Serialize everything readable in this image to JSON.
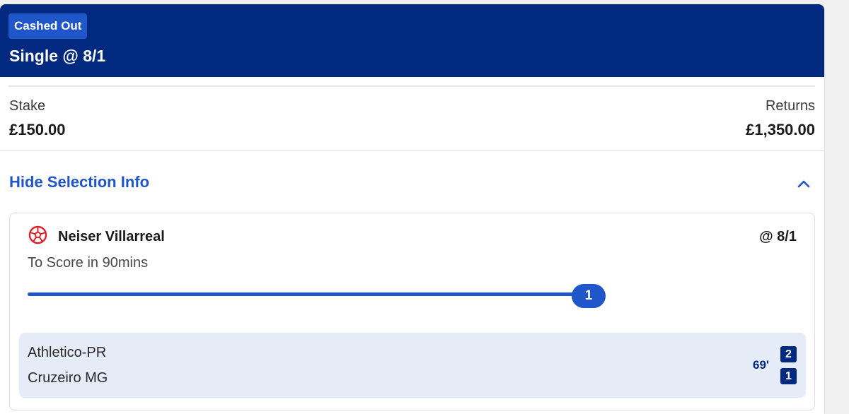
{
  "header": {
    "status_badge": "Cashed Out",
    "bet_title": "Single @ 8/1",
    "background_color": "#00297f",
    "badge_color": "#1f56c9"
  },
  "summary": {
    "stake_label": "Stake",
    "stake_value": "£150.00",
    "returns_label": "Returns",
    "returns_value": "£1,350.00"
  },
  "selection_toggle": {
    "label": "Hide Selection Info",
    "icon": "chevron-up-icon",
    "color": "#1f56c9"
  },
  "selection": {
    "sport_icon": "football-icon",
    "player": "Neiser Villarreal",
    "odds": "@ 8/1",
    "market": "To Score in 90mins",
    "progress": {
      "count": "1",
      "fraction": 1.0
    }
  },
  "match": {
    "home_team": "Athletico-PR",
    "away_team": "Cruzeiro MG",
    "clock": "69'",
    "home_score": "2",
    "away_score": "1"
  }
}
